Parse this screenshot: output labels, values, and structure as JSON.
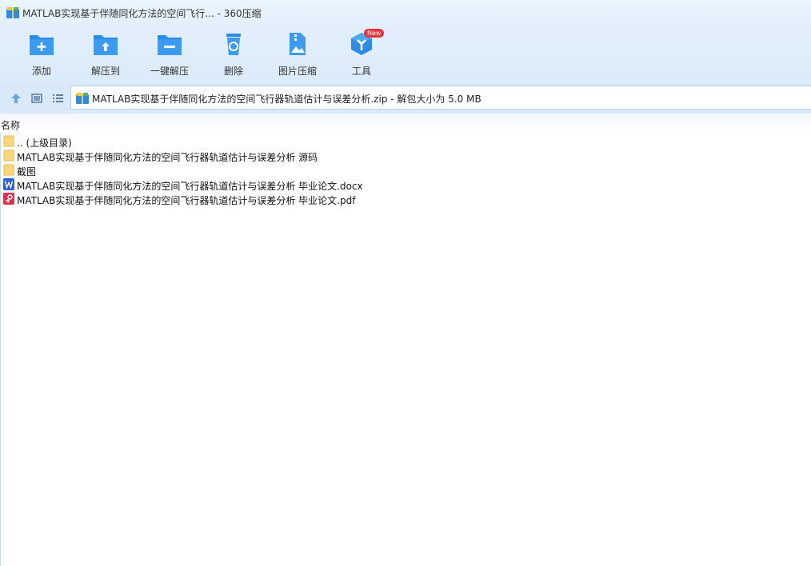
{
  "window": {
    "title": "MATLAB实现基于伴随同化方法的空间飞行... - 360压缩"
  },
  "toolbar": {
    "add_label": "添加",
    "extract_to_label": "解压到",
    "one_click_extract_label": "一键解压",
    "delete_label": "删除",
    "image_compress_label": "图片压缩",
    "tools_label": "工具",
    "tools_badge": "New"
  },
  "navbar": {
    "path": "MATLAB实现基于伴随同化方法的空间飞行器轨道估计与误差分析.zip - 解包大小为 5.0 MB"
  },
  "list": {
    "column_name": "名称",
    "items": [
      {
        "name": ".. (上级目录)",
        "icon": "folder-icon"
      },
      {
        "name": "MATLAB实现基于伴随同化方法的空间飞行器轨道估计与误差分析 源码",
        "icon": "folder-icon"
      },
      {
        "name": "截图",
        "icon": "folder-icon"
      },
      {
        "name": "MATLAB实现基于伴随同化方法的空间飞行器轨道估计与误差分析 毕业论文.docx",
        "icon": "word-icon"
      },
      {
        "name": "MATLAB实现基于伴随同化方法的空间飞行器轨道估计与误差分析 毕业论文.pdf",
        "icon": "pdf-icon"
      }
    ]
  },
  "colors": {
    "accent": "#2a8be8",
    "toolbar_bg": "#e3effb",
    "folder": "#f7d77a",
    "word": "#2b5fd9",
    "pdf": "#e0314b",
    "badge": "#e8323c"
  }
}
